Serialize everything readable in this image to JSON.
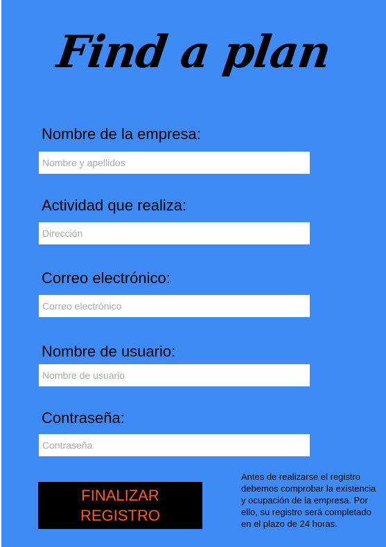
{
  "logo": {
    "text": "Find a plan"
  },
  "form": {
    "fields": [
      {
        "label": "Nombre de la empresa:",
        "placeholder": "Nombre y apellidos"
      },
      {
        "label": "Actividad que realiza:",
        "placeholder": "Dirección"
      },
      {
        "label": "Correo electrónico:",
        "placeholder": "Correo electrónico"
      },
      {
        "label": "Nombre de usuario:",
        "placeholder": "Nombre de usuario"
      },
      {
        "label": "Contraseña:",
        "placeholder": "Contraseña"
      }
    ],
    "submit": {
      "line1": "FINALIZAR",
      "line2": "REGISTRO"
    },
    "notice": "Antes de realizarse el registro debemos comprobar la existencia y ocupación de la empresa. Por ello, su registro será completado en el plazo de 24 horas."
  },
  "colors": {
    "panel_background": "#3f8bf5",
    "button_background": "#000000",
    "button_text": "#ff5a1c"
  }
}
